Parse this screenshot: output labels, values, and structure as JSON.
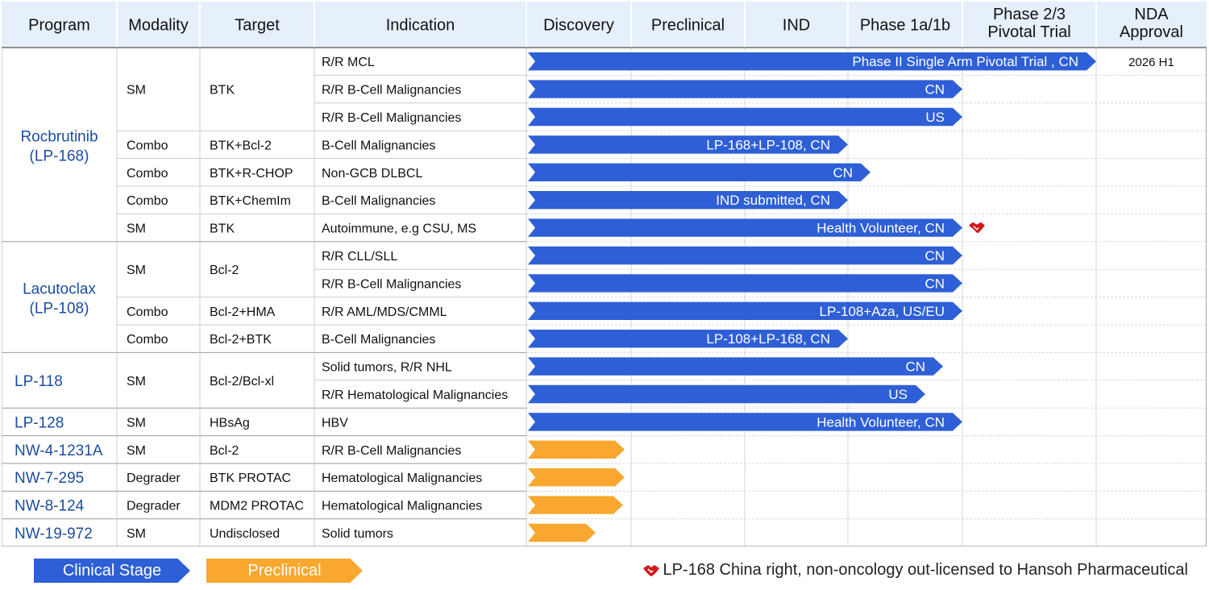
{
  "colors": {
    "header_bg": "#e6f0fb",
    "clinical": "#2e5fd6",
    "preclinical": "#f9a72e",
    "program_text": "#1b4d9e",
    "grid": "#cccccc",
    "handshake": "#d3171b"
  },
  "columns": [
    "Program",
    "Modality",
    "Target",
    "Indication",
    "Discovery",
    "Preclinical",
    "IND",
    "Phase 1a/1b",
    "Phase 2/3 Pivotal Trial",
    "NDA Approval"
  ],
  "column_lines": {
    "Phase 2/3 Pivotal Trial": [
      "Phase 2/3",
      "Pivotal Trial"
    ],
    "NDA Approval": [
      "NDA",
      "Approval"
    ]
  },
  "programs": [
    {
      "name": "Rocbrutinib",
      "code": "(LP-168)"
    },
    {
      "name": "Lacutoclax",
      "code": "(LP-108)"
    },
    {
      "name": "LP-118",
      "code": ""
    },
    {
      "name": "LP-128",
      "code": ""
    },
    {
      "name": "NW-4-1231A",
      "code": ""
    },
    {
      "name": "NW-7-295",
      "code": ""
    },
    {
      "name": "NW-8-124",
      "code": ""
    },
    {
      "name": "NW-19-972",
      "code": ""
    }
  ],
  "rows": [
    {
      "modality": "SM",
      "target": "BTK",
      "indication": "R/R MCL",
      "stage": "clinical",
      "progress": "Phase 2/3",
      "label": "Phase II Single Arm Pivotal Trial , CN",
      "nda": "2026 H1"
    },
    {
      "modality": "",
      "target": "",
      "indication": "R/R B-Cell Malignancies",
      "stage": "clinical",
      "progress": "Phase 1a/1b",
      "label": "CN"
    },
    {
      "modality": "",
      "target": "",
      "indication": "R/R B-Cell Malignancies",
      "stage": "clinical",
      "progress": "Phase 1a/1b",
      "label": "US"
    },
    {
      "modality": "Combo",
      "target": "BTK+Bcl-2",
      "indication": "B-Cell Malignancies",
      "stage": "clinical",
      "progress": "IND",
      "label": "LP-168+LP-108, CN"
    },
    {
      "modality": "Combo",
      "target": "BTK+R-CHOP",
      "indication": "Non-GCB DLBCL",
      "stage": "clinical",
      "progress": "Phase 1a/1b",
      "label": "CN"
    },
    {
      "modality": "Combo",
      "target": "BTK+ChemIm",
      "indication": "B-Cell Malignancies",
      "stage": "clinical",
      "progress": "IND",
      "label": "IND submitted, CN"
    },
    {
      "modality": "SM",
      "target": "BTK",
      "indication": "Autoimmune, e.g CSU, MS",
      "stage": "clinical",
      "progress": "Phase 1a/1b",
      "label": "Health Volunteer, CN",
      "licensed": true
    },
    {
      "modality": "SM",
      "target": "Bcl-2",
      "indication": "R/R CLL/SLL",
      "stage": "clinical",
      "progress": "Phase 1a/1b",
      "label": "CN"
    },
    {
      "modality": "",
      "target": "",
      "indication": "R/R B-Cell Malignancies",
      "stage": "clinical",
      "progress": "Phase 1a/1b",
      "label": "CN"
    },
    {
      "modality": "Combo",
      "target": "Bcl-2+HMA",
      "indication": "R/R AML/MDS/CMML",
      "stage": "clinical",
      "progress": "Phase 1a/1b",
      "label": "LP-108+Aza, US/EU"
    },
    {
      "modality": "Combo",
      "target": "Bcl-2+BTK",
      "indication": "B-Cell Malignancies",
      "stage": "clinical",
      "progress": "IND",
      "label": "LP-108+LP-168, CN"
    },
    {
      "modality": "SM",
      "target": "Bcl-2/Bcl-xl",
      "indication": "Solid tumors, R/R NHL",
      "stage": "clinical",
      "progress": "Phase 1a/1b",
      "label": "CN"
    },
    {
      "modality": "",
      "target": "",
      "indication": "R/R Hematological Malignancies",
      "stage": "clinical",
      "progress": "Phase 1a/1b",
      "label": "US"
    },
    {
      "modality": "SM",
      "target": "HBsAg",
      "indication": "HBV",
      "stage": "clinical",
      "progress": "Phase 1a/1b",
      "label": "Health Volunteer, CN"
    },
    {
      "modality": "SM",
      "target": "Bcl-2",
      "indication": "R/R B-Cell Malignancies",
      "stage": "preclinical",
      "progress": "Discovery",
      "label": ""
    },
    {
      "modality": "Degrader",
      "target": "BTK  PROTAC",
      "indication": "Hematological Malignancies",
      "stage": "preclinical",
      "progress": "Discovery",
      "label": ""
    },
    {
      "modality": "Degrader",
      "target": "MDM2 PROTAC",
      "indication": "Hematological Malignancies",
      "stage": "preclinical",
      "progress": "Discovery",
      "label": ""
    },
    {
      "modality": "SM",
      "target": "Undisclosed",
      "indication": "Solid tumors",
      "stage": "preclinical",
      "progress": "Discovery",
      "label": ""
    }
  ],
  "legend": {
    "clinical": "Clinical Stage",
    "preclinical": "Preclinical",
    "note": "LP-168 China right, non-oncology out-licensed to Hansoh Pharmaceutical"
  }
}
